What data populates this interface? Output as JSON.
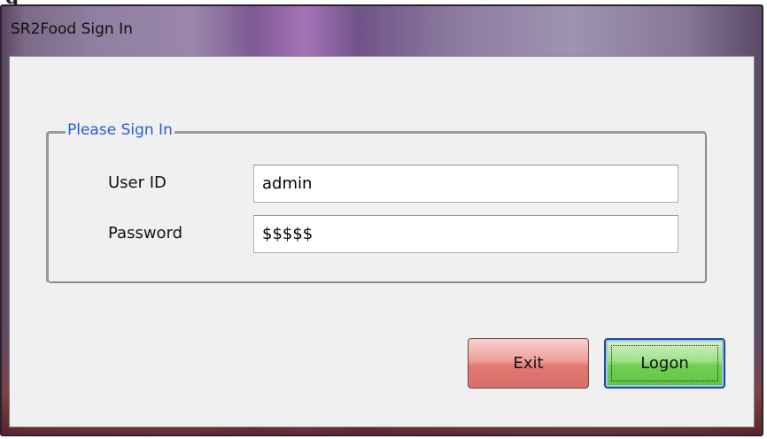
{
  "caption_fragment": "g",
  "window": {
    "title": "SR2Food Sign In"
  },
  "group": {
    "legend": "Please Sign In"
  },
  "fields": {
    "user_label": "User ID",
    "user_value": "admin",
    "password_label": "Password",
    "password_value": "$$$$$"
  },
  "buttons": {
    "exit_label": "Exit",
    "logon_label": "Logon"
  },
  "colors": {
    "legend_text": "#2a5cd6",
    "exit_button": "#e27a72",
    "logon_button": "#6fcf4f",
    "logon_border": "#1e4c8c"
  }
}
